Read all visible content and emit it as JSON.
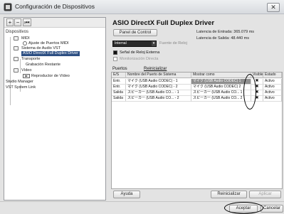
{
  "window": {
    "title": "Configuración de Dispositivos",
    "close_glyph": "✕"
  },
  "left_panel": {
    "toolbar": {
      "add": "+",
      "remove": "−",
      "reset": "⏮"
    },
    "header": "Dispositivos",
    "tree": [
      {
        "label": "MIDI"
      },
      {
        "label": "Ajuste de Puertos MIDI"
      },
      {
        "label": "Sistema de Audio VST"
      },
      {
        "label": "ASIO DirectX Full Duplex Driver"
      },
      {
        "label": "Transporte"
      },
      {
        "label": "Grabación Restante"
      },
      {
        "label": "Vídeo"
      },
      {
        "label": "Reproductor de Vídeo"
      },
      {
        "label": "Studio Manager"
      },
      {
        "label": "VST System Link"
      }
    ]
  },
  "driver": {
    "title": "ASIO DirectX Full Duplex Driver",
    "control_panel_button": "Panel de Control",
    "input_latency": "Latencia de Entrada: 365.079 ms",
    "output_latency": "Latencia de Salida:   48.440 ms",
    "clock_source_value": "Internal",
    "clock_source_label": "Fuente de Reloj",
    "external_clock_label": "Señal de Reloj Externa",
    "external_clock_checked": true,
    "direct_monitoring_label": "Monitorización Directa",
    "direct_monitoring_checked": false
  },
  "tabs": {
    "ports": "Puertos",
    "reset": "Reinicializar"
  },
  "ports_table": {
    "columns": [
      "E/S",
      "Nombre del Puerto de Sistema",
      "Mostrar como",
      "Visible",
      "Estado"
    ],
    "rows": [
      {
        "io": "Entr.",
        "name": "マイク (USB Audio CODEC) - 1",
        "display": "マイク (USB Audio CODEC) 1",
        "visible": "✖",
        "status": "Activo"
      },
      {
        "io": "Entr.",
        "name": "マイク (USB Audio CODEC) - 2",
        "display": "マイク (USB Audio CODEC) 2",
        "visible": "✖",
        "status": "Activo"
      },
      {
        "io": "Salida",
        "name": "スピーカー (USB Audio CO... - 1",
        "display": "スピーカー (USB Audio CO... 1",
        "visible": "✖",
        "status": "Activo"
      },
      {
        "io": "Salida",
        "name": "スピーカー (USB Audio CO... - 2",
        "display": "スピーカー (USB Audio CO... 2",
        "visible": "✖",
        "status": "Activo"
      }
    ]
  },
  "footer": {
    "help": "Ayuda",
    "reset": "Reinicializar",
    "apply": "Aplicar",
    "accept": "Aceptar",
    "cancel": "Cancelar"
  },
  "colors": {
    "selected_tree_bg": "#2d4f83",
    "highlight_cell_bg": "#8e8e8e"
  }
}
